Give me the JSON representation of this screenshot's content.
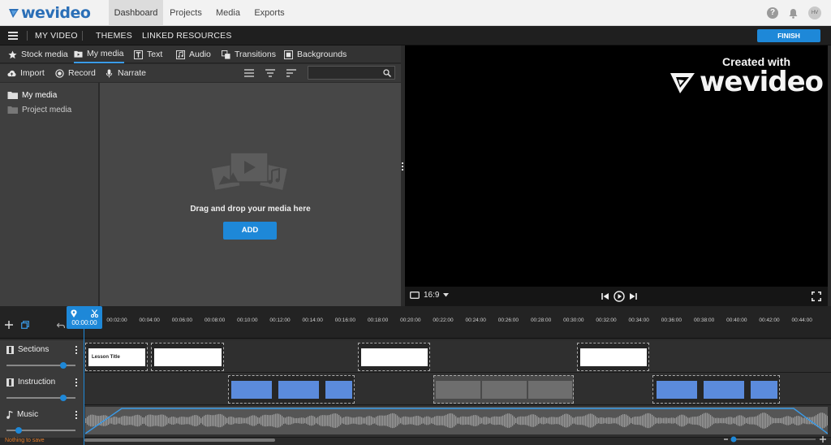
{
  "app": {
    "brand": "wevideo",
    "watermark_line1": "Created with",
    "watermark_line2": "wevideo"
  },
  "topnav": {
    "tabs": [
      "Dashboard",
      "Projects",
      "Media",
      "Exports"
    ],
    "active": "Dashboard",
    "help": "?",
    "avatar": "HV"
  },
  "editorbar": {
    "project": "MY VIDEO",
    "themes": "THEMES",
    "linked": "LINKED RESOURCES",
    "finish": "FINISH"
  },
  "mediatabs": [
    {
      "label": "Stock media",
      "icon": "star-icon"
    },
    {
      "label": "My media",
      "icon": "folder-video-icon",
      "active": true
    },
    {
      "label": "Text",
      "icon": "text-icon"
    },
    {
      "label": "Audio",
      "icon": "audio-icon"
    },
    {
      "label": "Transitions",
      "icon": "transitions-icon"
    },
    {
      "label": "Backgrounds",
      "icon": "backgrounds-icon"
    }
  ],
  "tools": {
    "import": "Import",
    "record": "Record",
    "narrate": "Narrate",
    "search_placeholder": ""
  },
  "folders": [
    "My media",
    "Project media"
  ],
  "dropzone": {
    "text": "Drag and drop your media here",
    "add": "ADD"
  },
  "preview": {
    "ratio": "16:9"
  },
  "timeline": {
    "playhead_time": "00:00:00",
    "ticks": [
      "00:02:00",
      "00:04:00",
      "00:06:00",
      "00:08:00",
      "00:10:00",
      "00:12:00",
      "00:14:00",
      "00:16:00",
      "00:18:00",
      "00:20:00",
      "00:22:00",
      "00:24:00",
      "00:26:00",
      "00:28:00",
      "00:30:00",
      "00:32:00",
      "00:34:00",
      "00:36:00",
      "00:38:00",
      "00:40:00",
      "00:42:00",
      "00:44:00"
    ],
    "tracks": [
      {
        "name": "Sections",
        "icon": "film-icon",
        "volume": 0.82
      },
      {
        "name": "Instruction",
        "icon": "film-icon",
        "volume": 0.82
      },
      {
        "name": "Music",
        "icon": "music-note-icon",
        "volume": 0.18
      }
    ],
    "lesson_title": "Lesson Title"
  },
  "status": "Nothing to save",
  "colors": {
    "accent": "#1e88d8",
    "status": "#e07b2a"
  }
}
